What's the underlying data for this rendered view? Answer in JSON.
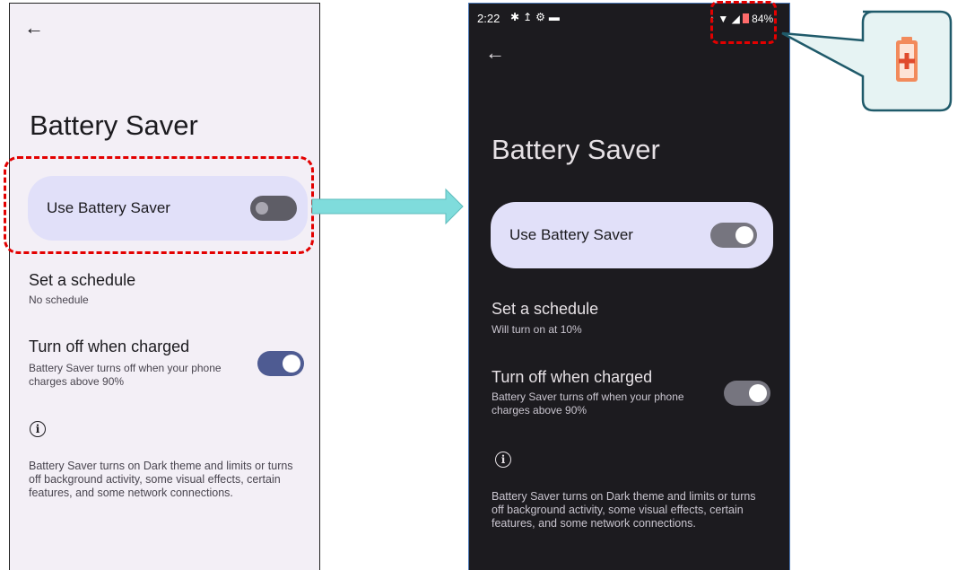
{
  "light_screen": {
    "title": "Battery Saver",
    "use_battery_saver_label": "Use Battery Saver",
    "use_battery_saver_state": "off",
    "schedule_title": "Set a schedule",
    "schedule_subtitle": "No schedule",
    "turn_off_title": "Turn off when charged",
    "turn_off_subtitle": "Battery Saver turns off when your phone charges above 90%",
    "turn_off_state": "on",
    "footer_text": "Battery Saver turns on Dark theme and limits or turns off background activity, some visual effects, certain features, and some network connections."
  },
  "dark_screen": {
    "status_time": "2:22",
    "status_icons": [
      "gear-icon",
      "upload-icon",
      "settings-icon",
      "notification-icon"
    ],
    "battery_percent": "84%",
    "title": "Battery Saver",
    "use_battery_saver_label": "Use Battery Saver",
    "use_battery_saver_state": "on",
    "schedule_title": "Set a schedule",
    "schedule_subtitle": "Will turn on at 10%",
    "turn_off_title": "Turn off when charged",
    "turn_off_subtitle": "Battery Saver turns off when your phone charges above 90%",
    "turn_off_state": "on",
    "footer_text": "Battery Saver turns on Dark theme and limits or turns off background activity, some visual effects, certain features, and some network connections."
  },
  "annotations": {
    "highlight_color": "#e30000",
    "arrow_color": "#7fdcdc",
    "callout_icon": "battery-saver-icon",
    "callout_icon_color": "#f28a5b"
  }
}
